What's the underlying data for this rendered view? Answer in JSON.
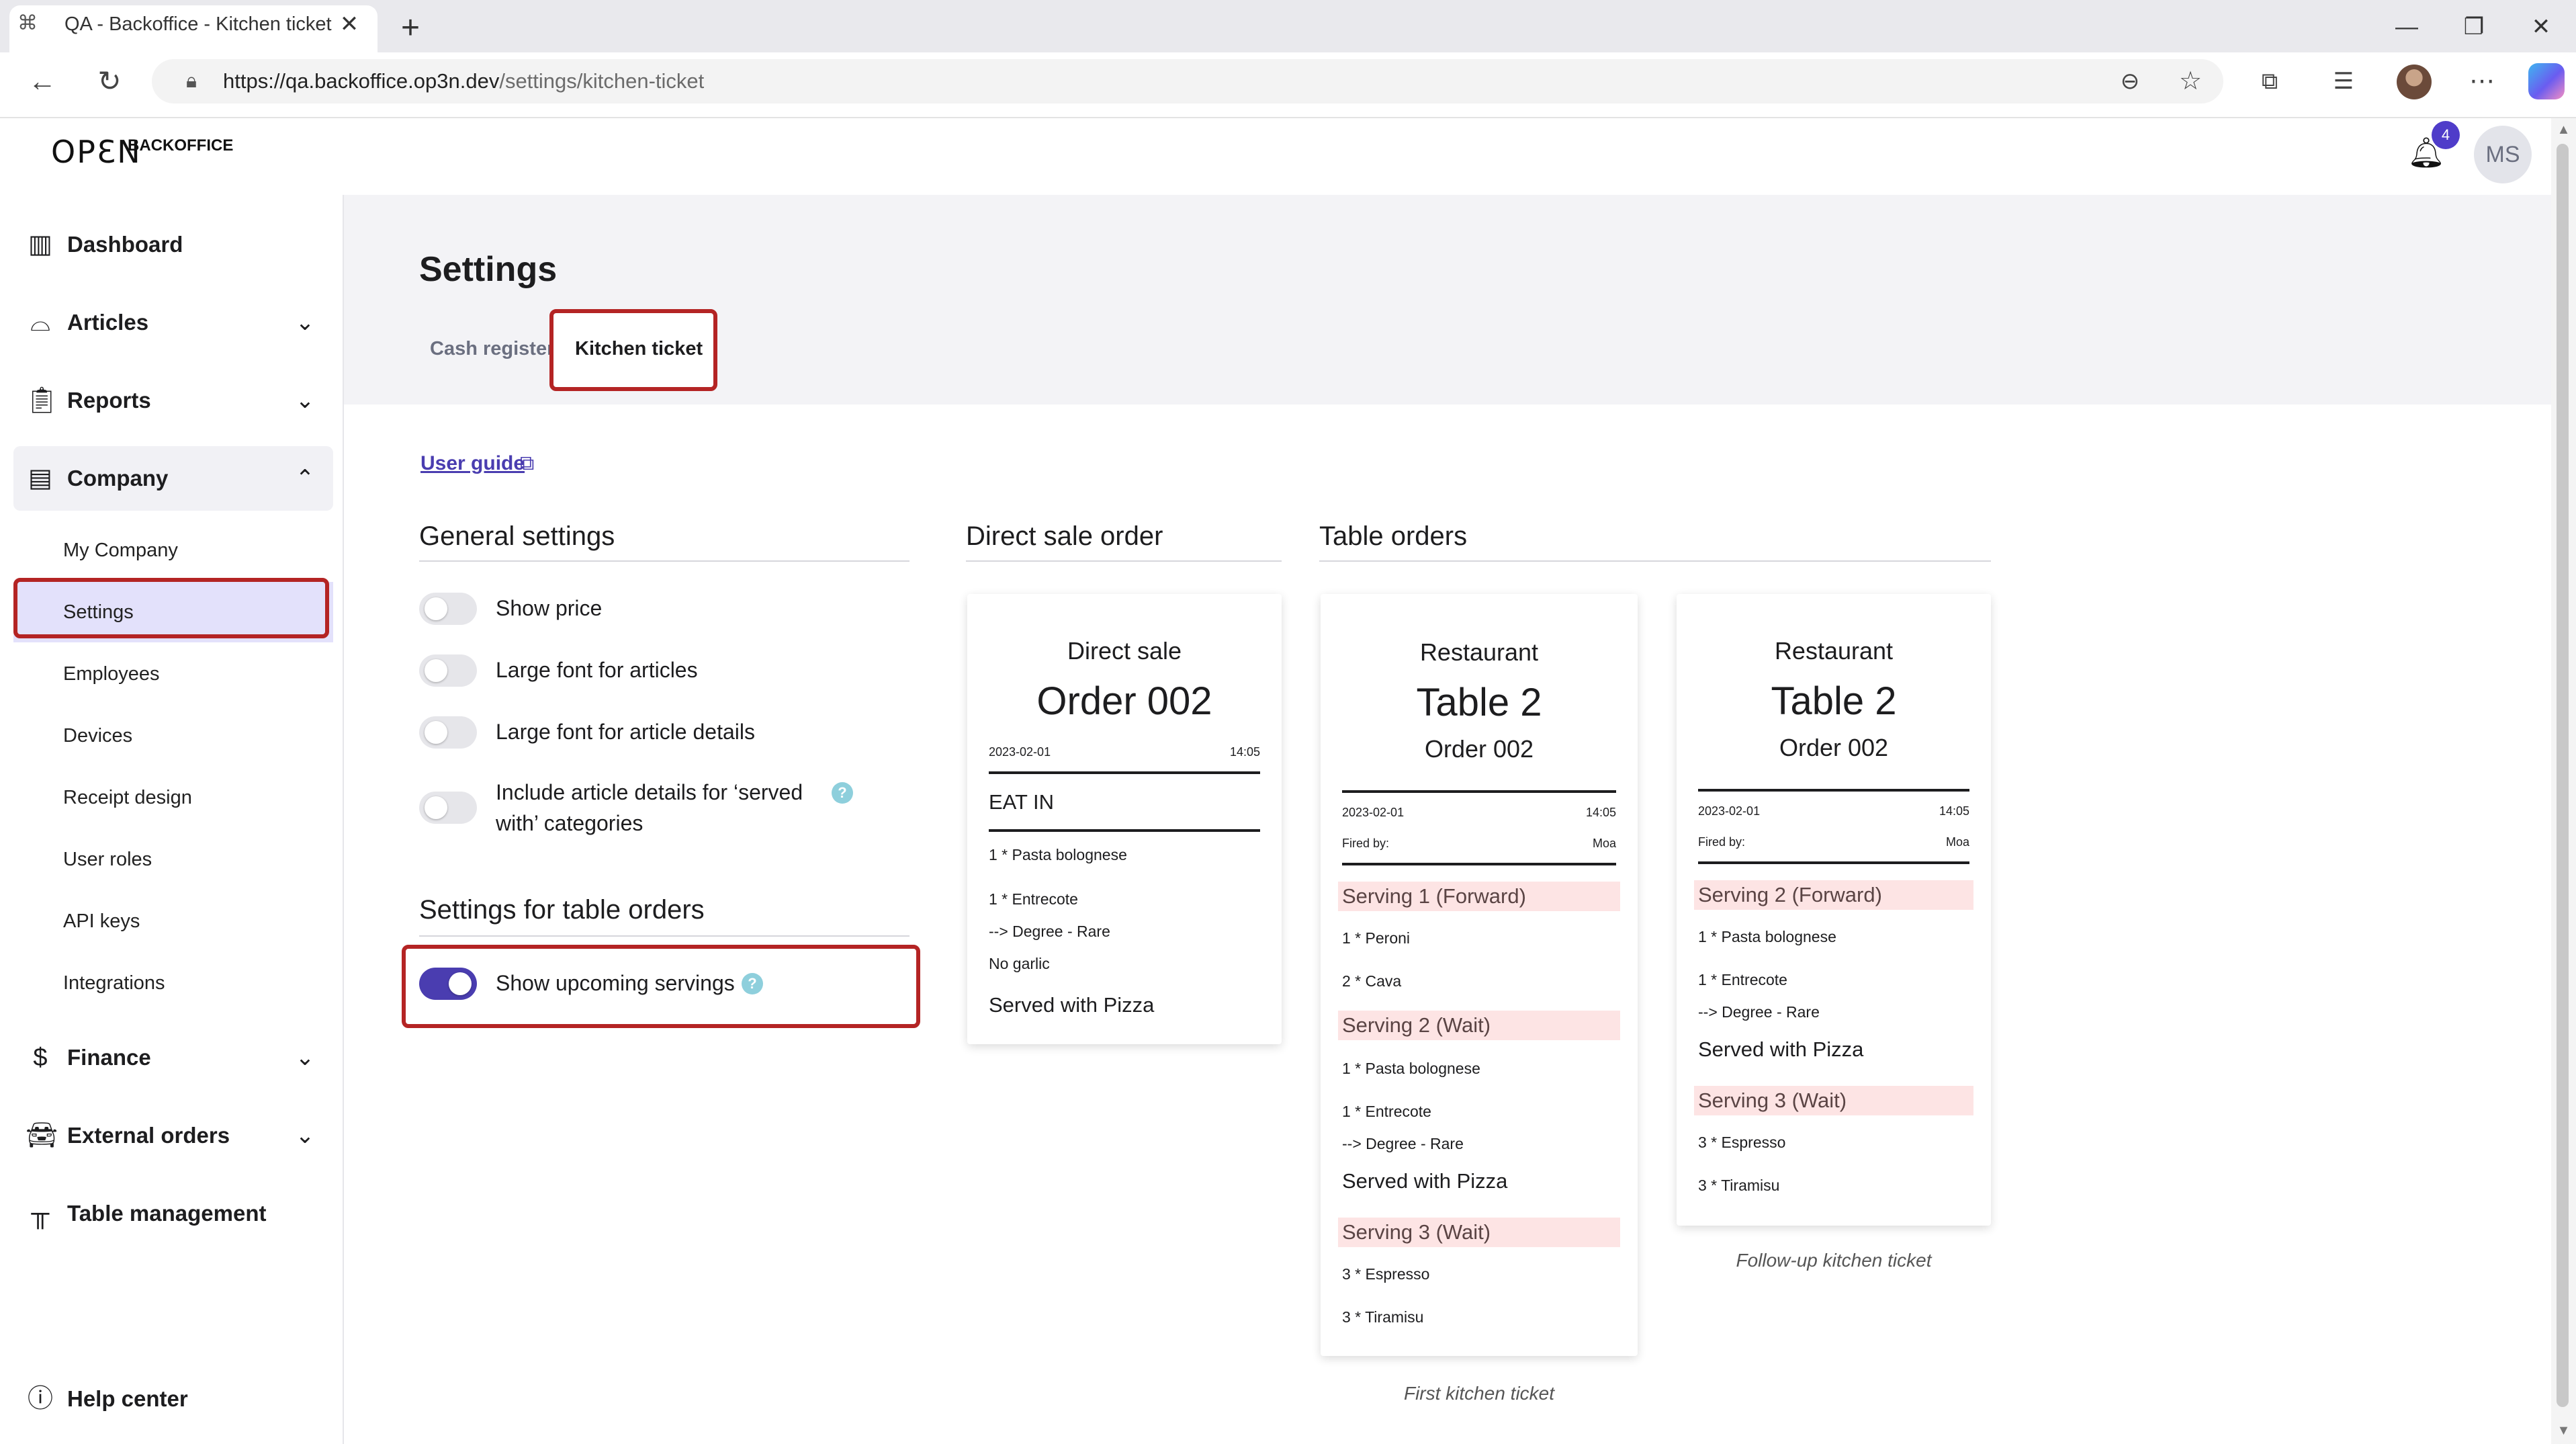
{
  "browser": {
    "tab_title": "QA - Backoffice - Kitchen ticket se",
    "tab_close": "✕",
    "new_tab": "+",
    "url_host": "https://qa.backoffice.op3n.dev",
    "url_path": "/settings/kitchen-ticket",
    "icons": [
      "back-icon",
      "reload-icon",
      "lock-icon",
      "zoom-out-icon",
      "star-icon",
      "extensions-icon",
      "favorites-icon",
      "profile-icon",
      "more-icon",
      "copilot-icon",
      "minimize-icon",
      "restore-icon",
      "close-icon"
    ]
  },
  "header": {
    "logo_open": "OPƐN",
    "logo_backoffice": "BACKOFFICE",
    "notification_count": "4",
    "user_initials": "MS"
  },
  "sidebar": {
    "items": [
      {
        "label": "Dashboard",
        "icon": "chart-icon"
      },
      {
        "label": "Articles",
        "icon": "food-tray-icon"
      },
      {
        "label": "Reports",
        "icon": "clipboard-icon"
      },
      {
        "label": "Company",
        "icon": "store-icon"
      },
      {
        "label": "Finance",
        "icon": "dollar-icon"
      },
      {
        "label": "External orders",
        "icon": "car-icon"
      },
      {
        "label": "Table management",
        "icon": "table-icon"
      },
      {
        "label": "Help center",
        "icon": "help-circle-icon"
      }
    ],
    "company_sub": [
      "My Company",
      "Settings",
      "Employees",
      "Devices",
      "Receipt design",
      "User roles",
      "API keys",
      "Integrations"
    ],
    "active_sub": "Settings"
  },
  "main": {
    "title": "Settings",
    "tabs": [
      "Cash register",
      "Kitchen ticket"
    ],
    "active_tab": "Kitchen ticket",
    "user_guide": "User guide",
    "general_title": "General settings",
    "general_settings": [
      {
        "label": "Show price",
        "on": false
      },
      {
        "label": "Large font for articles",
        "on": false
      },
      {
        "label": "Large font for article details",
        "on": false
      },
      {
        "label_line1": "Include article details for ‘served",
        "label_line2": "with’ categories",
        "on": false
      }
    ],
    "table_settings_title": "Settings for table orders",
    "table_settings": [
      {
        "label": "Show upcoming servings",
        "on": true
      }
    ],
    "direct_sale_title": "Direct sale order",
    "table_orders_title": "Table orders"
  },
  "tickets": {
    "direct": {
      "heading": "Direct sale",
      "order": "Order 002",
      "date": "2023-02-01",
      "time": "14:05",
      "mode": "EAT IN",
      "lines": [
        "1 * Pasta bolognese",
        "1 * Entrecote",
        "--> Degree - Rare",
        "No garlic"
      ],
      "served_with": "Served with Pizza"
    },
    "first": {
      "heading": "Restaurant",
      "table": "Table 2",
      "order": "Order 002",
      "date": "2023-02-01",
      "time": "14:05",
      "fired_by_label": "Fired by:",
      "fired_by": "Moa",
      "serving1": "Serving 1 (Forward)",
      "s1_lines": [
        "1 * Peroni",
        "2 * Cava"
      ],
      "serving2": "Serving 2 (Wait)",
      "s2_lines": [
        "1 * Pasta bolognese",
        "1 * Entrecote",
        "--> Degree - Rare"
      ],
      "s2_served": "Served with Pizza",
      "serving3": "Serving 3 (Wait)",
      "s3_lines": [
        "3 * Espresso",
        "3 * Tiramisu"
      ],
      "caption": "First kitchen ticket"
    },
    "followup": {
      "heading": "Restaurant",
      "table": "Table 2",
      "order": "Order 002",
      "date": "2023-02-01",
      "time": "14:05",
      "fired_by_label": "Fired by:",
      "fired_by": "Moa",
      "serving2": "Serving 2 (Forward)",
      "s2_lines": [
        "1 * Pasta bolognese",
        "1 * Entrecote",
        "--> Degree - Rare"
      ],
      "s2_served": "Served with Pizza",
      "serving3": "Serving 3 (Wait)",
      "s3_lines": [
        "3 * Espresso",
        "3 * Tiramisu"
      ],
      "caption": "Follow-up kitchen ticket"
    }
  },
  "colors": {
    "accent": "#4a3db0",
    "highlight_border": "#b42424",
    "serving_bar": "#fde4e4",
    "sub_active": "#e3e1fb"
  }
}
